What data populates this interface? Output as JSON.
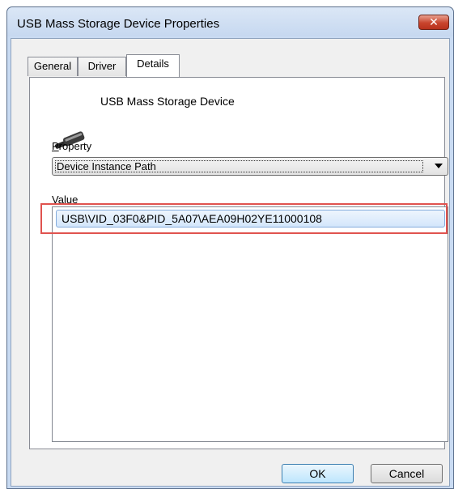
{
  "window": {
    "title": "USB Mass Storage Device Properties",
    "close_glyph": "✕"
  },
  "tabs": [
    {
      "label": "General",
      "active": false
    },
    {
      "label": "Driver",
      "active": false
    },
    {
      "label": "Details",
      "active": true
    }
  ],
  "details": {
    "device_name": "USB Mass Storage Device",
    "device_icon": "usb-drive-icon",
    "property_label_accel": "P",
    "property_label_rest": "roperty",
    "property_selected": "Device Instance Path",
    "value_label_accel": "V",
    "value_label_rest": "alue",
    "value_items": [
      "USB\\VID_03F0&PID_5A07\\AEA09H02YE11000108"
    ]
  },
  "buttons": {
    "ok": "OK",
    "cancel": "Cancel"
  },
  "colors": {
    "highlight": "#e0534f",
    "selection": "#d3e6fb"
  }
}
